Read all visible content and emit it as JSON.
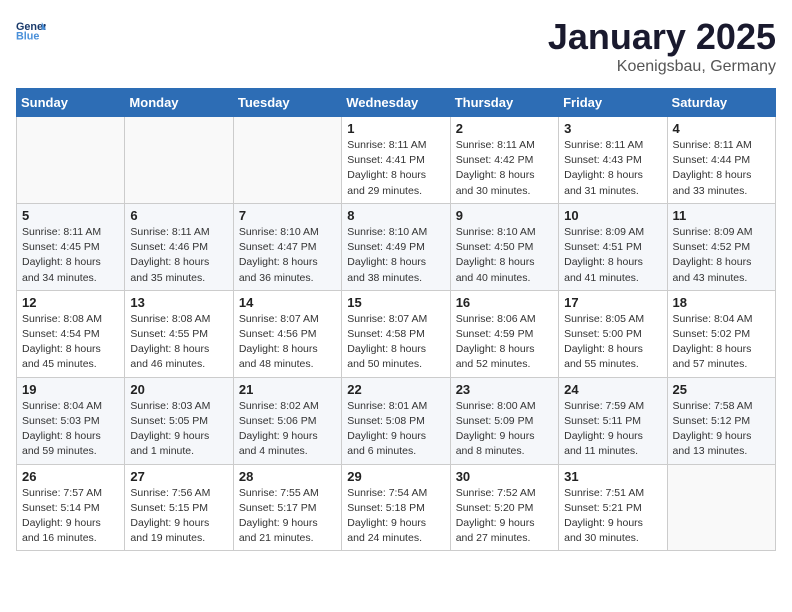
{
  "header": {
    "logo_general": "General",
    "logo_blue": "Blue",
    "month": "January 2025",
    "location": "Koenigsbau, Germany"
  },
  "weekdays": [
    "Sunday",
    "Monday",
    "Tuesday",
    "Wednesday",
    "Thursday",
    "Friday",
    "Saturday"
  ],
  "weeks": [
    [
      {
        "day": "",
        "sunrise": "",
        "sunset": "",
        "daylight": ""
      },
      {
        "day": "",
        "sunrise": "",
        "sunset": "",
        "daylight": ""
      },
      {
        "day": "",
        "sunrise": "",
        "sunset": "",
        "daylight": ""
      },
      {
        "day": "1",
        "sunrise": "Sunrise: 8:11 AM",
        "sunset": "Sunset: 4:41 PM",
        "daylight": "Daylight: 8 hours and 29 minutes."
      },
      {
        "day": "2",
        "sunrise": "Sunrise: 8:11 AM",
        "sunset": "Sunset: 4:42 PM",
        "daylight": "Daylight: 8 hours and 30 minutes."
      },
      {
        "day": "3",
        "sunrise": "Sunrise: 8:11 AM",
        "sunset": "Sunset: 4:43 PM",
        "daylight": "Daylight: 8 hours and 31 minutes."
      },
      {
        "day": "4",
        "sunrise": "Sunrise: 8:11 AM",
        "sunset": "Sunset: 4:44 PM",
        "daylight": "Daylight: 8 hours and 33 minutes."
      }
    ],
    [
      {
        "day": "5",
        "sunrise": "Sunrise: 8:11 AM",
        "sunset": "Sunset: 4:45 PM",
        "daylight": "Daylight: 8 hours and 34 minutes."
      },
      {
        "day": "6",
        "sunrise": "Sunrise: 8:11 AM",
        "sunset": "Sunset: 4:46 PM",
        "daylight": "Daylight: 8 hours and 35 minutes."
      },
      {
        "day": "7",
        "sunrise": "Sunrise: 8:10 AM",
        "sunset": "Sunset: 4:47 PM",
        "daylight": "Daylight: 8 hours and 36 minutes."
      },
      {
        "day": "8",
        "sunrise": "Sunrise: 8:10 AM",
        "sunset": "Sunset: 4:49 PM",
        "daylight": "Daylight: 8 hours and 38 minutes."
      },
      {
        "day": "9",
        "sunrise": "Sunrise: 8:10 AM",
        "sunset": "Sunset: 4:50 PM",
        "daylight": "Daylight: 8 hours and 40 minutes."
      },
      {
        "day": "10",
        "sunrise": "Sunrise: 8:09 AM",
        "sunset": "Sunset: 4:51 PM",
        "daylight": "Daylight: 8 hours and 41 minutes."
      },
      {
        "day": "11",
        "sunrise": "Sunrise: 8:09 AM",
        "sunset": "Sunset: 4:52 PM",
        "daylight": "Daylight: 8 hours and 43 minutes."
      }
    ],
    [
      {
        "day": "12",
        "sunrise": "Sunrise: 8:08 AM",
        "sunset": "Sunset: 4:54 PM",
        "daylight": "Daylight: 8 hours and 45 minutes."
      },
      {
        "day": "13",
        "sunrise": "Sunrise: 8:08 AM",
        "sunset": "Sunset: 4:55 PM",
        "daylight": "Daylight: 8 hours and 46 minutes."
      },
      {
        "day": "14",
        "sunrise": "Sunrise: 8:07 AM",
        "sunset": "Sunset: 4:56 PM",
        "daylight": "Daylight: 8 hours and 48 minutes."
      },
      {
        "day": "15",
        "sunrise": "Sunrise: 8:07 AM",
        "sunset": "Sunset: 4:58 PM",
        "daylight": "Daylight: 8 hours and 50 minutes."
      },
      {
        "day": "16",
        "sunrise": "Sunrise: 8:06 AM",
        "sunset": "Sunset: 4:59 PM",
        "daylight": "Daylight: 8 hours and 52 minutes."
      },
      {
        "day": "17",
        "sunrise": "Sunrise: 8:05 AM",
        "sunset": "Sunset: 5:00 PM",
        "daylight": "Daylight: 8 hours and 55 minutes."
      },
      {
        "day": "18",
        "sunrise": "Sunrise: 8:04 AM",
        "sunset": "Sunset: 5:02 PM",
        "daylight": "Daylight: 8 hours and 57 minutes."
      }
    ],
    [
      {
        "day": "19",
        "sunrise": "Sunrise: 8:04 AM",
        "sunset": "Sunset: 5:03 PM",
        "daylight": "Daylight: 8 hours and 59 minutes."
      },
      {
        "day": "20",
        "sunrise": "Sunrise: 8:03 AM",
        "sunset": "Sunset: 5:05 PM",
        "daylight": "Daylight: 9 hours and 1 minute."
      },
      {
        "day": "21",
        "sunrise": "Sunrise: 8:02 AM",
        "sunset": "Sunset: 5:06 PM",
        "daylight": "Daylight: 9 hours and 4 minutes."
      },
      {
        "day": "22",
        "sunrise": "Sunrise: 8:01 AM",
        "sunset": "Sunset: 5:08 PM",
        "daylight": "Daylight: 9 hours and 6 minutes."
      },
      {
        "day": "23",
        "sunrise": "Sunrise: 8:00 AM",
        "sunset": "Sunset: 5:09 PM",
        "daylight": "Daylight: 9 hours and 8 minutes."
      },
      {
        "day": "24",
        "sunrise": "Sunrise: 7:59 AM",
        "sunset": "Sunset: 5:11 PM",
        "daylight": "Daylight: 9 hours and 11 minutes."
      },
      {
        "day": "25",
        "sunrise": "Sunrise: 7:58 AM",
        "sunset": "Sunset: 5:12 PM",
        "daylight": "Daylight: 9 hours and 13 minutes."
      }
    ],
    [
      {
        "day": "26",
        "sunrise": "Sunrise: 7:57 AM",
        "sunset": "Sunset: 5:14 PM",
        "daylight": "Daylight: 9 hours and 16 minutes."
      },
      {
        "day": "27",
        "sunrise": "Sunrise: 7:56 AM",
        "sunset": "Sunset: 5:15 PM",
        "daylight": "Daylight: 9 hours and 19 minutes."
      },
      {
        "day": "28",
        "sunrise": "Sunrise: 7:55 AM",
        "sunset": "Sunset: 5:17 PM",
        "daylight": "Daylight: 9 hours and 21 minutes."
      },
      {
        "day": "29",
        "sunrise": "Sunrise: 7:54 AM",
        "sunset": "Sunset: 5:18 PM",
        "daylight": "Daylight: 9 hours and 24 minutes."
      },
      {
        "day": "30",
        "sunrise": "Sunrise: 7:52 AM",
        "sunset": "Sunset: 5:20 PM",
        "daylight": "Daylight: 9 hours and 27 minutes."
      },
      {
        "day": "31",
        "sunrise": "Sunrise: 7:51 AM",
        "sunset": "Sunset: 5:21 PM",
        "daylight": "Daylight: 9 hours and 30 minutes."
      },
      {
        "day": "",
        "sunrise": "",
        "sunset": "",
        "daylight": ""
      }
    ]
  ]
}
